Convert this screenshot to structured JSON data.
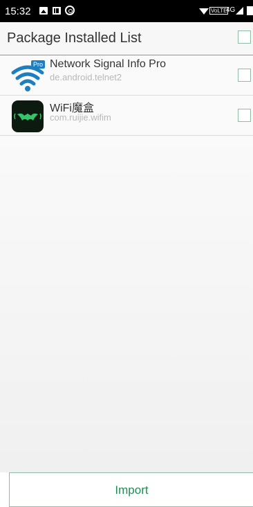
{
  "status_bar": {
    "time": "15:32",
    "volte": "VoLTE",
    "network": "4G"
  },
  "header": {
    "title": "Package Installed List"
  },
  "apps": [
    {
      "name": "Network Signal Info Pro",
      "package": "de.android.telnet2",
      "icon": "wifi-pro-icon",
      "badge": "Pro"
    },
    {
      "name": "WiFi魔盒",
      "package": "com.ruijie.wifim",
      "icon": "bat-wifi-icon"
    }
  ],
  "import_button": {
    "label": "Import"
  },
  "colors": {
    "accent": "#1f8d52",
    "border": "#8fbca4"
  }
}
